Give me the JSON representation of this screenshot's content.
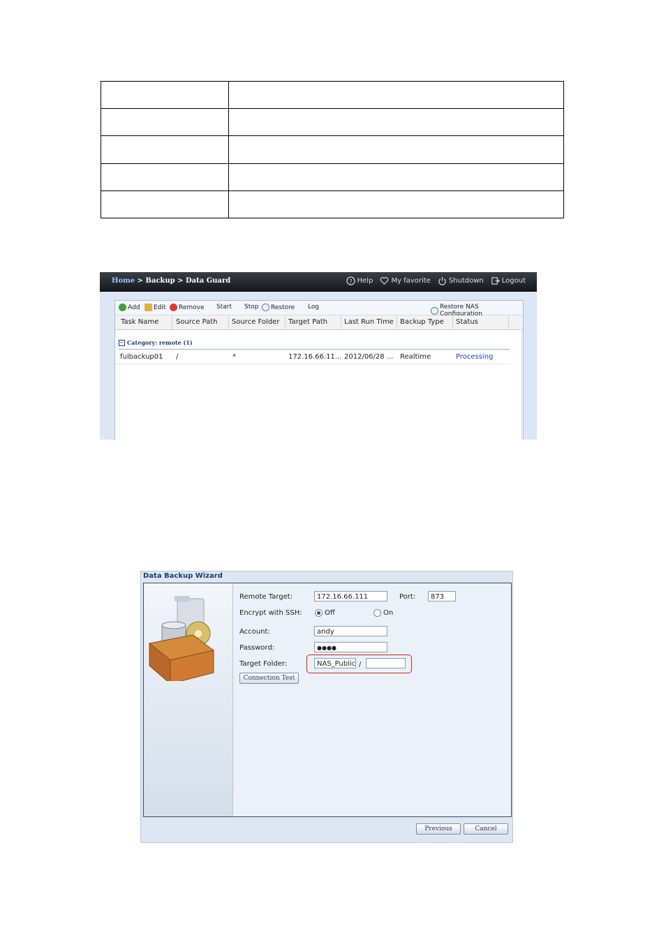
{
  "shot1": {
    "breadcrumb": {
      "home": "Home",
      "sep1": " > ",
      "backup": "Backup",
      "sep2": " > ",
      "current": "Data Guard"
    },
    "topnav": {
      "help": "Help",
      "favorite": "My favorite",
      "shutdown": "Shutdown",
      "logout": "Logout"
    },
    "toolbar": {
      "add": "Add",
      "edit": "Edit",
      "remove": "Remove",
      "start": "Start",
      "stop": "Stop",
      "restore": "Restore",
      "log": "Log",
      "restore_nas": "Restore NAS Configuration"
    },
    "columns": [
      "Task Name",
      "Source Path",
      "Source Folder",
      "Target Path",
      "Last Run Time",
      "Backup Type",
      "Status"
    ],
    "category": "Category: remote (1)",
    "rows": [
      {
        "task": "fulbackup01",
        "source_path": "/",
        "source_folder": "*",
        "target_path": "172.16.66.11...",
        "last_run": "2012/06/28 ...",
        "type": "Realtime",
        "status": "Processing"
      }
    ],
    "colors": {
      "status": "#1f3fb8",
      "topbar": "#1f2328"
    }
  },
  "wizard": {
    "title": "Data Backup Wizard",
    "labels": {
      "remote_target": "Remote Target:",
      "port": "Port:",
      "encrypt": "Encrypt with SSH:",
      "account": "Account:",
      "password": "Password:",
      "target_folder": "Target Folder:"
    },
    "values": {
      "remote_target": "172.16.66.111",
      "port": "873",
      "account": "andy",
      "password": "●●●●",
      "target_folder": "NAS_Public",
      "sub_folder": ""
    },
    "radios": {
      "off": "Off",
      "on": "On",
      "selected": "off"
    },
    "folder_sep": "/",
    "buttons": {
      "connection_test": "Connection Test",
      "previous": "Previous",
      "cancel": "Cancel"
    },
    "highlight_color": "#d41f1f"
  }
}
